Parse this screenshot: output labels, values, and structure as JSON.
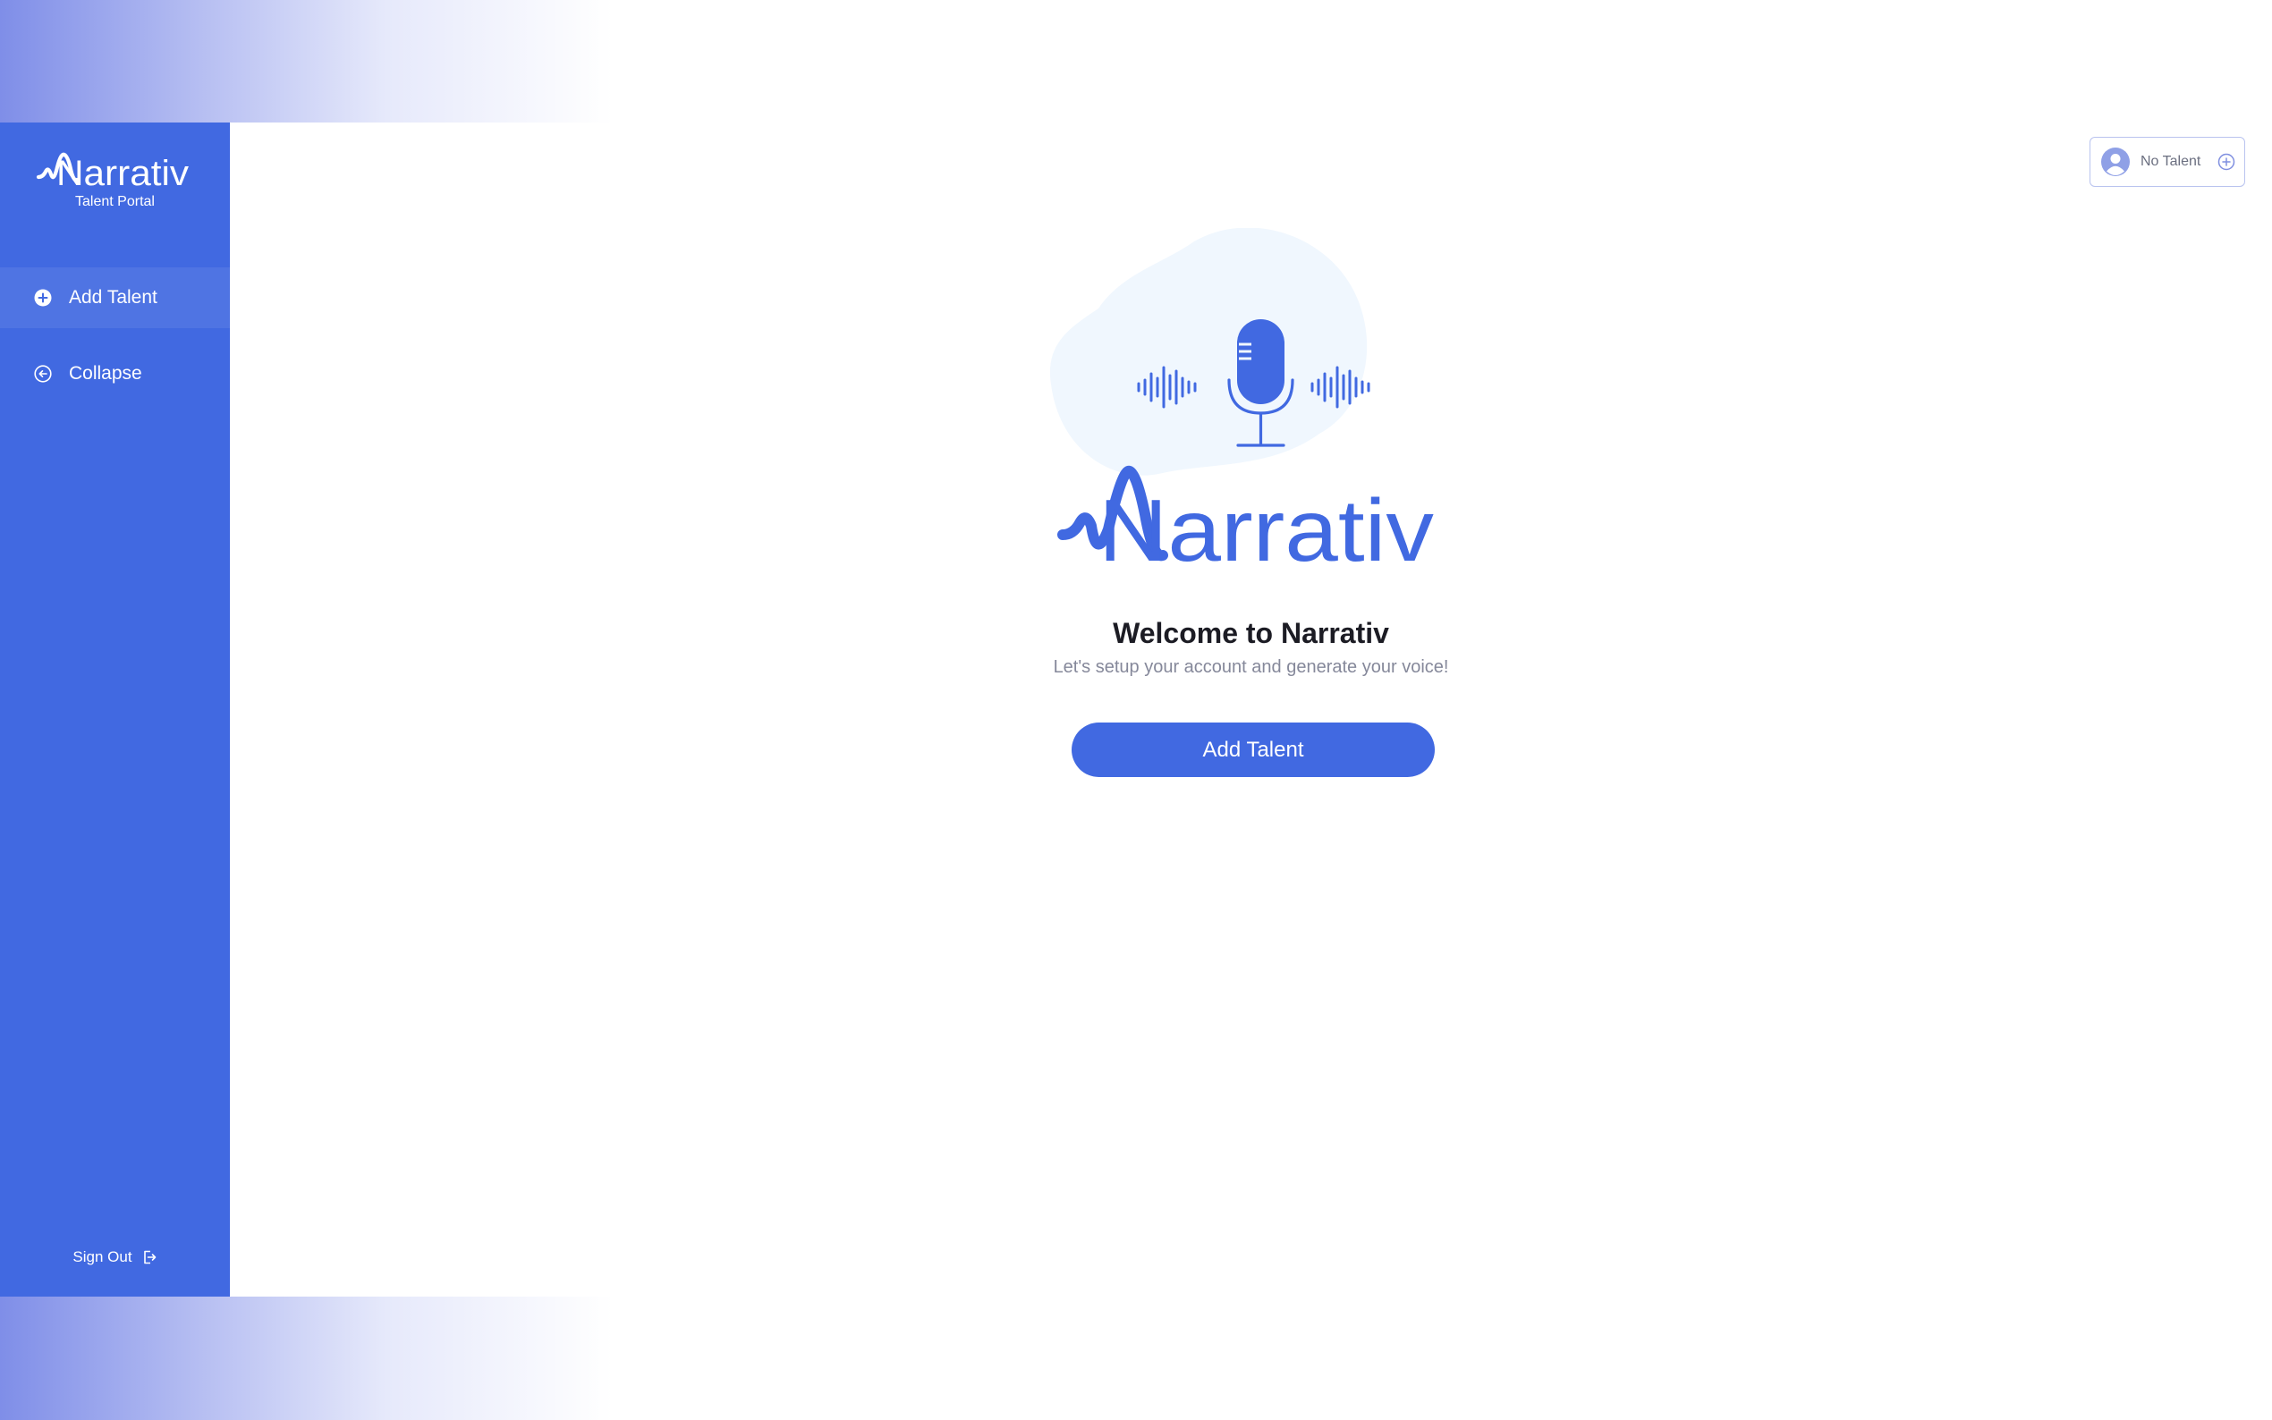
{
  "sidebar": {
    "logo_text": "Narrativ",
    "logo_subtitle": "Talent Portal",
    "items": [
      {
        "label": "Add Talent",
        "icon": "plus-circle-icon"
      },
      {
        "label": "Collapse",
        "icon": "arrow-left-circle-icon"
      }
    ],
    "signout_label": "Sign Out",
    "signout_icon": "sign-out-icon"
  },
  "header": {
    "talent_selector_label": "No Talent",
    "talent_selector_icons": [
      "user-avatar-icon",
      "plus-circle-icon"
    ]
  },
  "main": {
    "hero_brand": "Narrativ",
    "hero_icon": "microphone-icon",
    "title": "Welcome to Narrativ",
    "subtitle": "Let's setup your account and generate your voice!",
    "cta_label": "Add Talent"
  },
  "colors": {
    "primary": "#4169e1",
    "blob": "#f0f7fe",
    "title_text": "#1c1c24",
    "muted_text": "#85889a"
  }
}
